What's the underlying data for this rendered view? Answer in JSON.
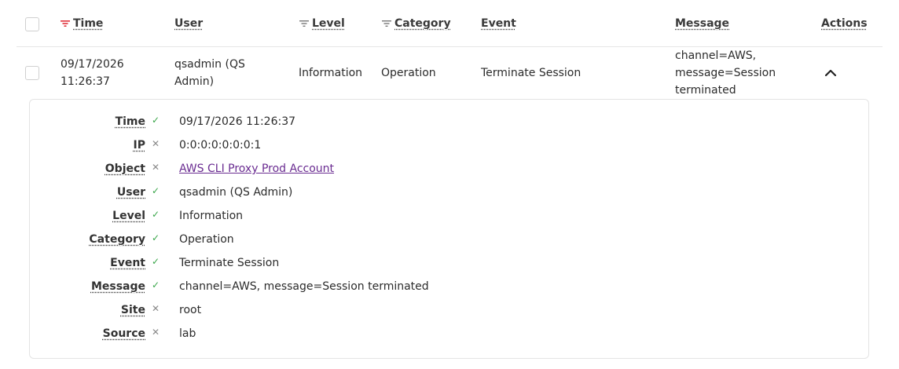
{
  "table": {
    "headers": {
      "time": "Time",
      "user": "User",
      "level": "Level",
      "category": "Category",
      "event": "Event",
      "message": "Message",
      "actions": "Actions"
    },
    "row": {
      "time_line1": "09/17/2026",
      "time_line2": "11:26:37",
      "user_line1": "qsadmin (QS",
      "user_line2": "Admin)",
      "level": "Information",
      "category": "Operation",
      "event": "Terminate Session",
      "message_line1": "channel=AWS,",
      "message_line2": "message=Session",
      "message_line3": "terminated"
    },
    "sort_color": "#e0303a"
  },
  "details": {
    "fields": [
      {
        "label": "Time",
        "value": "09/17/2026 11:26:37",
        "check": "✓"
      },
      {
        "label": "IP",
        "value": "0:0:0:0:0:0:0:1",
        "check": "✕"
      },
      {
        "label": "Object",
        "value": "AWS CLI Proxy Prod Account",
        "check": "✕"
      },
      {
        "label": "User",
        "value": "qsadmin (QS Admin)",
        "check": "✓"
      },
      {
        "label": "Level",
        "value": "Information",
        "check": "✓"
      },
      {
        "label": "Category",
        "value": "Operation",
        "check": "✓"
      },
      {
        "label": "Event",
        "value": "Terminate Session",
        "check": "✓"
      },
      {
        "label": "Message",
        "value": "channel=AWS, message=Session terminated",
        "check": "✓"
      },
      {
        "label": "Site",
        "value": "root",
        "check": "✕"
      },
      {
        "label": "Source",
        "value": "lab",
        "check": "✕"
      }
    ]
  }
}
